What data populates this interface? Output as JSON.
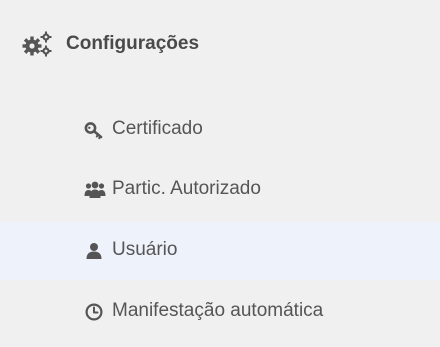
{
  "menu": {
    "header": {
      "title": "Configurações",
      "icon": "gears-icon"
    },
    "items": [
      {
        "label": "Certificado",
        "icon": "key-icon",
        "active": false
      },
      {
        "label": "Partic. Autorizado",
        "icon": "users-icon",
        "active": false
      },
      {
        "label": "Usuário",
        "icon": "user-icon",
        "active": true
      },
      {
        "label": "Manifestação automática",
        "icon": "clock-icon",
        "active": false
      }
    ]
  },
  "colors": {
    "background": "#f0f0f0",
    "active_background": "#eef2fa",
    "text": "#555555",
    "icon": "#555555"
  }
}
